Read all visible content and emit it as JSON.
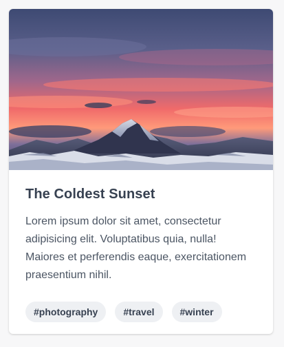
{
  "card": {
    "title": "The Coldest Sunset",
    "description": "Lorem ipsum dolor sit amet, consectetur adipisicing elit. Voluptatibus quia, nulla! Maiores et perferendis eaque, exercitationem praesentium nihil.",
    "tags": [
      "#photography",
      "#travel",
      "#winter"
    ]
  },
  "colors": {
    "title": "#374151",
    "text": "#4b5563",
    "tag_bg": "#eef0f3",
    "card_bg": "#ffffff",
    "page_bg": "#f7f7f8"
  }
}
